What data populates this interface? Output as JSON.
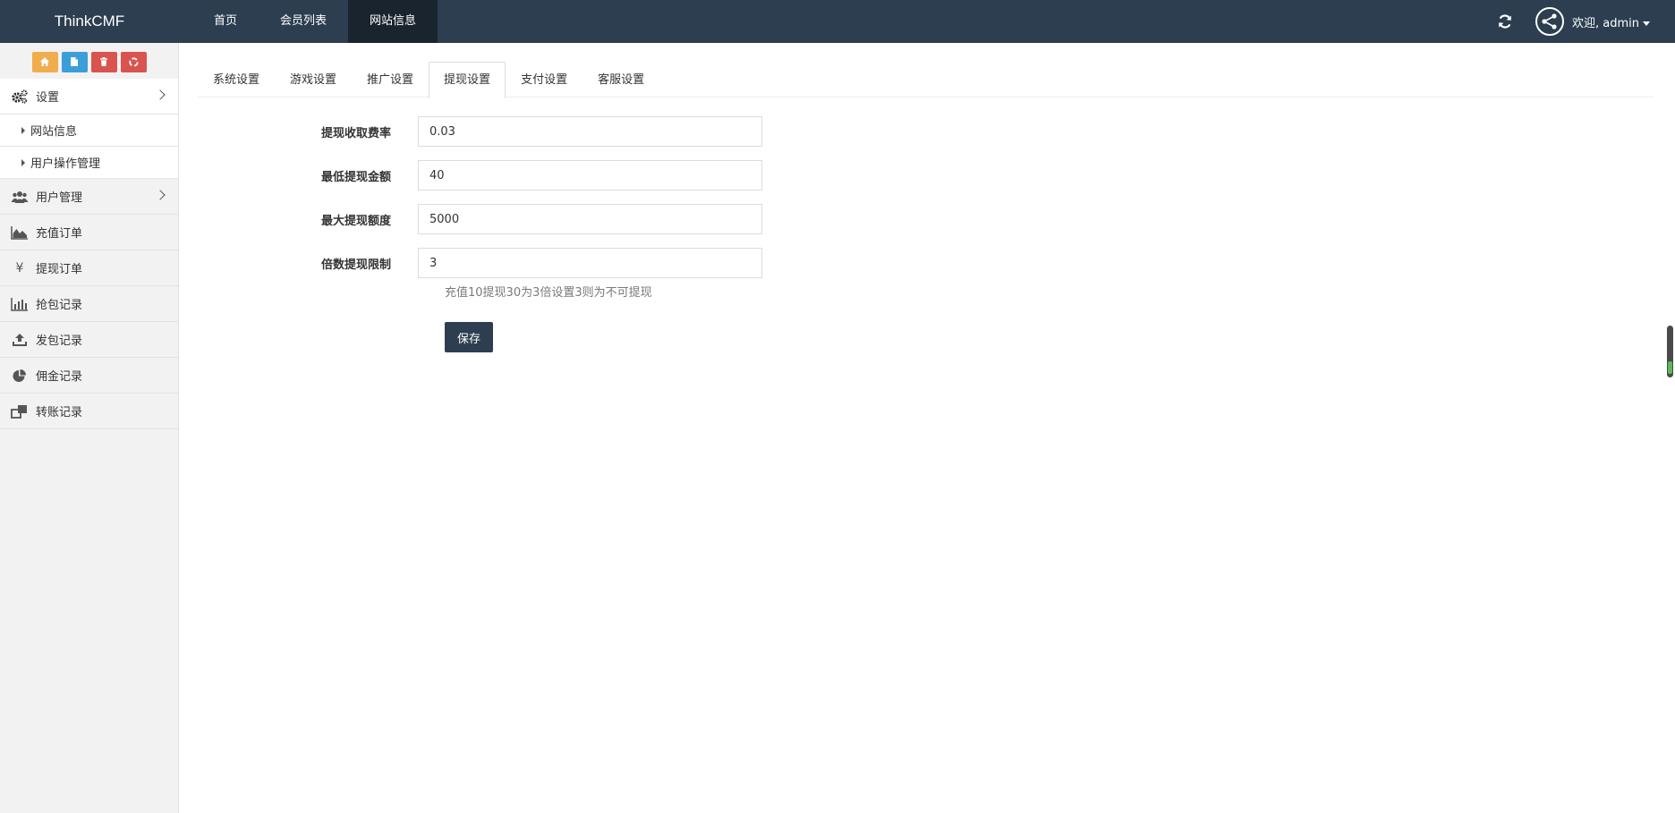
{
  "header": {
    "brand": "ThinkCMF",
    "nav": [
      "首页",
      "会员列表",
      "网站信息"
    ],
    "active_nav": "网站信息",
    "welcome": "欢迎, admin"
  },
  "sidebar": {
    "quick_buttons": [
      {
        "icon": "home-icon",
        "color": "#f0ad4e"
      },
      {
        "icon": "file-icon",
        "color": "#3a9ed9"
      },
      {
        "icon": "trash-icon",
        "color": "#d9534f"
      },
      {
        "icon": "recycle-icon",
        "color": "#d9534f"
      }
    ],
    "settings_label": "设置",
    "settings_sub": [
      "网站信息",
      "用户操作管理"
    ],
    "items": [
      "用户管理",
      "充值订单",
      "提现订单",
      "抢包记录",
      "发包记录",
      "佣金记录",
      "转账记录"
    ]
  },
  "tabs": [
    "系统设置",
    "游戏设置",
    "推广设置",
    "提现设置",
    "支付设置",
    "客服设置"
  ],
  "active_tab": "提现设置",
  "form": {
    "fields": [
      {
        "label": "提现收取费率",
        "value": "0.03"
      },
      {
        "label": "最低提现金额",
        "value": "40"
      },
      {
        "label": "最大提现额度",
        "value": "5000"
      },
      {
        "label": "倍数提现限制",
        "value": "3"
      }
    ],
    "help": "充值10提现30为3倍设置3则为不可提现",
    "save_label": "保存"
  },
  "colors": {
    "topbar": "#2c3e50",
    "active_nav": "#1a242f",
    "save_button": "#2c3e50"
  }
}
